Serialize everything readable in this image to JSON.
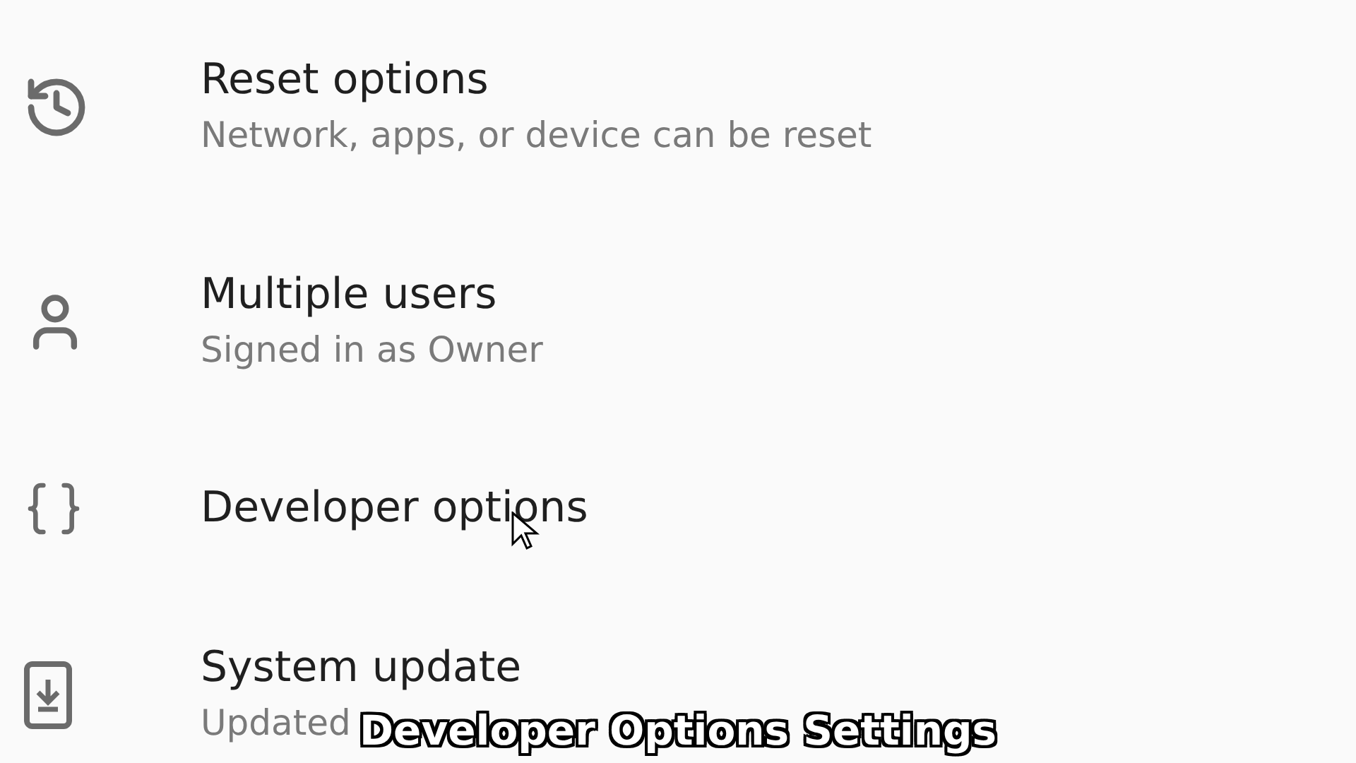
{
  "settings": [
    {
      "kind": "reset",
      "title": "Reset options",
      "subtitle": "Network, apps, or device can be reset"
    },
    {
      "kind": "users",
      "title": "Multiple users",
      "subtitle": "Signed in as Owner"
    },
    {
      "kind": "developer",
      "title": "Developer options"
    },
    {
      "kind": "update",
      "title": "System update",
      "subtitle": "Updated"
    }
  ],
  "caption": "Developer Options Settings"
}
